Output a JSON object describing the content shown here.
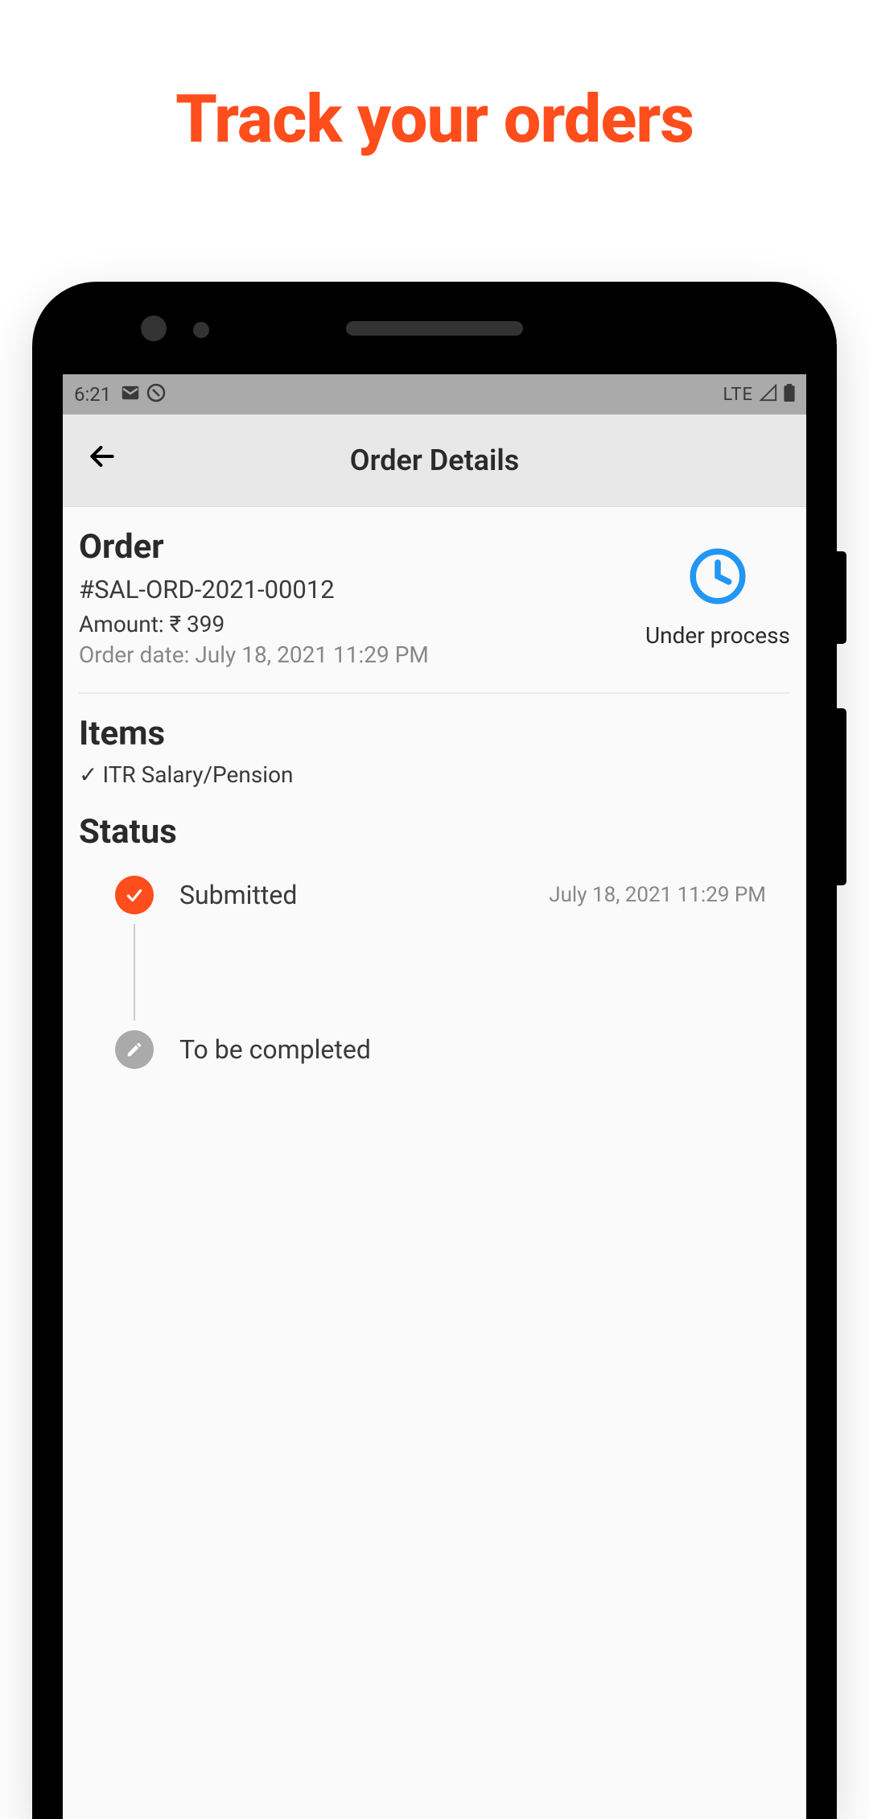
{
  "marketing": {
    "headline": "Track your orders"
  },
  "status_bar": {
    "time": "6:21",
    "network": "LTE"
  },
  "header": {
    "title": "Order Details"
  },
  "order": {
    "heading": "Order",
    "id": "#SAL-ORD-2021-00012",
    "amount_label": "Amount: ₹ 399",
    "date_label": "Order date: July 18, 2021 11:29 PM",
    "status_label": "Under process"
  },
  "items": {
    "heading": "Items",
    "list": [
      "ITR Salary/Pension"
    ]
  },
  "status": {
    "heading": "Status",
    "timeline": [
      {
        "label": "Submitted",
        "date": "July 18, 2021 11:29 PM",
        "state": "done"
      },
      {
        "label": "To be completed",
        "date": "",
        "state": "pending"
      }
    ]
  },
  "colors": {
    "accent": "#ff4d1c",
    "processing": "#2196f3"
  }
}
